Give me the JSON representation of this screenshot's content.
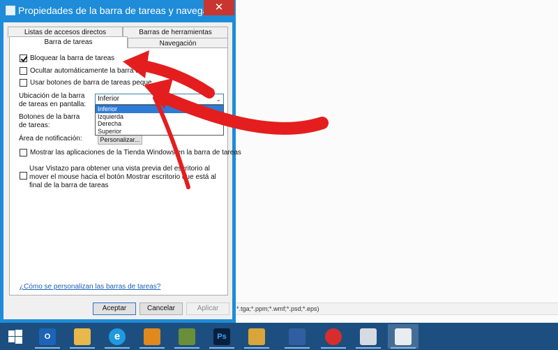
{
  "background": {
    "status_text": "*.tga;*.ppm;*.wmf;*.psd;*.eps)"
  },
  "dialog": {
    "title": "Propiedades de la barra de tareas y navegaci...",
    "close_glyph": "✕",
    "tabs": {
      "row1": [
        "Listas de accesos directos",
        "Barras de herramientas"
      ],
      "row2": [
        "Barra de tareas",
        "Navegación"
      ],
      "active": "Barra de tareas"
    },
    "options": {
      "lock_taskbar": "Bloquear la barra de tareas",
      "autohide": "Ocultar automáticamente la barra de",
      "small_buttons": "Usar botones de barra de tareas peque",
      "location_label": "Ubicación de la barra de tareas en pantalla:",
      "buttons_label": "Botones de la barra de tareas:",
      "notification_label": "Área de notificación:",
      "customize_button": "Personalizar...",
      "store_apps": "Mostrar las aplicaciones de la Tienda Windows en la barra de tareas",
      "peek": "Usar Vistazo para obtener una vista previa del escritorio al mover el mouse hacia el botón Mostrar escritorio que está al final de la barra de tareas"
    },
    "checkbox_states": {
      "lock_taskbar": true,
      "autohide": false,
      "small_buttons": false,
      "store_apps": false,
      "peek": false
    },
    "location_select": {
      "value": "Inferior",
      "options": [
        "Inferior",
        "Izquierda",
        "Derecha",
        "Superior"
      ],
      "highlighted": "Inferior"
    },
    "help_link": "¿Cómo se personalizan las barras de tareas?",
    "buttons": {
      "accept": "Aceptar",
      "cancel": "Cancelar",
      "apply": "Aplicar"
    }
  },
  "taskbar": {
    "items": [
      {
        "icon": "windows-start-icon"
      },
      {
        "icon": "outlook-icon"
      },
      {
        "icon": "file-explorer-icon"
      },
      {
        "icon": "internet-explorer-icon"
      },
      {
        "icon": "app-icon"
      },
      {
        "icon": "image-viewer-icon"
      },
      {
        "icon": "photoshop-icon",
        "text": "Ps"
      },
      {
        "icon": "paint-icon"
      },
      {
        "icon": "virtualbox-icon"
      },
      {
        "icon": "app-red-icon"
      },
      {
        "icon": "folder-icon"
      },
      {
        "icon": "taskbar-properties-icon"
      }
    ]
  },
  "colors": {
    "title_bar": "#1e8cd8",
    "close_button": "#c7372f",
    "taskbar": "#1c4f80",
    "selection": "#2e7bd6",
    "arrow": "#e41e1e"
  }
}
